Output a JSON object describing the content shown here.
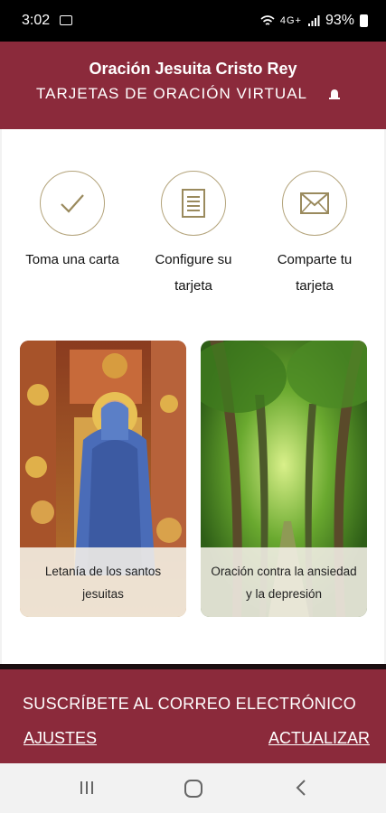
{
  "status_bar": {
    "time": "3:02",
    "signal_text": "4G+",
    "battery": "93%"
  },
  "header": {
    "title": "Oración Jesuita Cristo Rey",
    "subtitle": "TARJETAS DE ORACIÓN VIRTUAL"
  },
  "steps": [
    {
      "label": "Toma una carta",
      "icon": "checkmark-icon"
    },
    {
      "label": "Configure su tarjeta",
      "icon": "document-icon"
    },
    {
      "label": "Comparte tu tarjeta",
      "icon": "envelope-icon"
    }
  ],
  "cards": [
    {
      "caption": "Letanía de los santos jesuitas"
    },
    {
      "caption": "Oración contra la ansiedad y la depresión"
    }
  ],
  "footer": {
    "subscribe": "SUSCRÍBETE AL CORREO ELECTRÓNICO",
    "settings": "AJUSTES",
    "update": "ACTUALIZAR"
  },
  "colors": {
    "brand": "#8b2a3b",
    "accent_gold": "#b3a37a"
  }
}
